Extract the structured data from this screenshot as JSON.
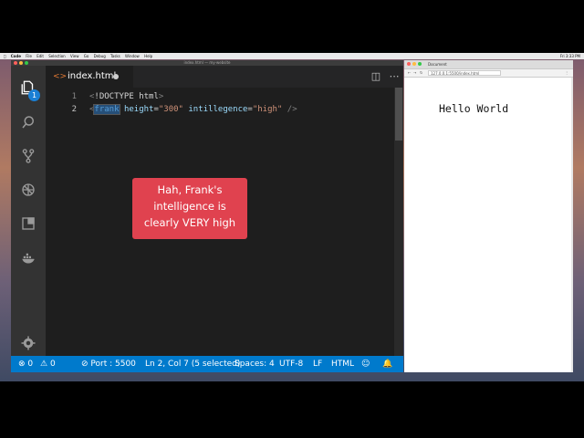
{
  "menubar": {
    "app": "Code",
    "items": [
      "File",
      "Edit",
      "Selection",
      "View",
      "Go",
      "Debug",
      "Tasks",
      "Window",
      "Help"
    ],
    "clock": "Fri 3:33 PM"
  },
  "vscode": {
    "window_title": "index.html — my-website",
    "activity": {
      "explorer_badge": "1"
    },
    "tab": {
      "icon": "<>",
      "label": "index.html"
    },
    "editor": {
      "lines": [
        {
          "number": "1"
        },
        {
          "number": "2"
        }
      ],
      "line1": {
        "open": "<",
        "bang": "!DOCTYPE html",
        "close": ">"
      },
      "line2": {
        "open": "<",
        "tag": "frank",
        "attr1": "height",
        "eq1": "=",
        "val1": "\"300\"",
        "attr2": "intillegence",
        "eq2": "=",
        "val2": "\"high\"",
        "close": " />"
      }
    },
    "callout": {
      "line1": "Hah, Frank's",
      "line2": "intelligence is",
      "line3": "clearly VERY high"
    },
    "statusbar": {
      "errors": "0",
      "warnings": "0",
      "port": "Port : 5500",
      "cursor": "Ln 2, Col 7 (5 selected)",
      "spaces": "Spaces: 4",
      "encoding": "UTF-8",
      "eol": "LF",
      "language": "HTML"
    }
  },
  "browser": {
    "tab_title": "Document",
    "url": "127.0.0.1:5500/index.html",
    "body_text": "Hello World"
  },
  "colors": {
    "status_blue": "#007acc",
    "callout_red": "#e0424f",
    "badge_blue": "#1a7fd4"
  }
}
